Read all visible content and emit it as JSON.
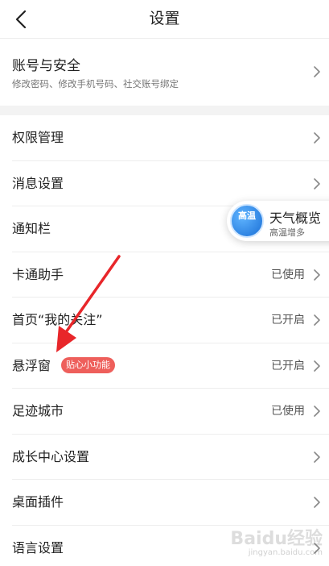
{
  "header": {
    "title": "设置"
  },
  "account": {
    "label": "账号与安全",
    "subtitle": "修改密码、修改手机号码、社交账号绑定"
  },
  "rows": [
    {
      "label": "权限管理",
      "status": ""
    },
    {
      "label": "消息设置",
      "status": ""
    },
    {
      "label": "通知栏",
      "status": ""
    },
    {
      "label": "卡通助手",
      "status": "已使用"
    },
    {
      "label": "首页“我的关注”",
      "status": "已开启"
    },
    {
      "label": "悬浮窗",
      "status": "已开启",
      "badge": "贴心小功能"
    },
    {
      "label": "足迹城市",
      "status": "已使用"
    },
    {
      "label": "成长中心设置",
      "status": ""
    },
    {
      "label": "桌面插件",
      "status": ""
    },
    {
      "label": "语言设置",
      "status": ""
    }
  ],
  "weather_widget": {
    "icon_text": "高温",
    "title": "天气概览",
    "subtitle": "高温增多"
  },
  "watermark": {
    "logo": "Baidu经验",
    "url": "jingyan.baidu.com"
  },
  "colors": {
    "accent_badge": "#ee5f5b",
    "annotation_arrow": "#e8262a",
    "weather_blue": "#1a6fd6"
  }
}
